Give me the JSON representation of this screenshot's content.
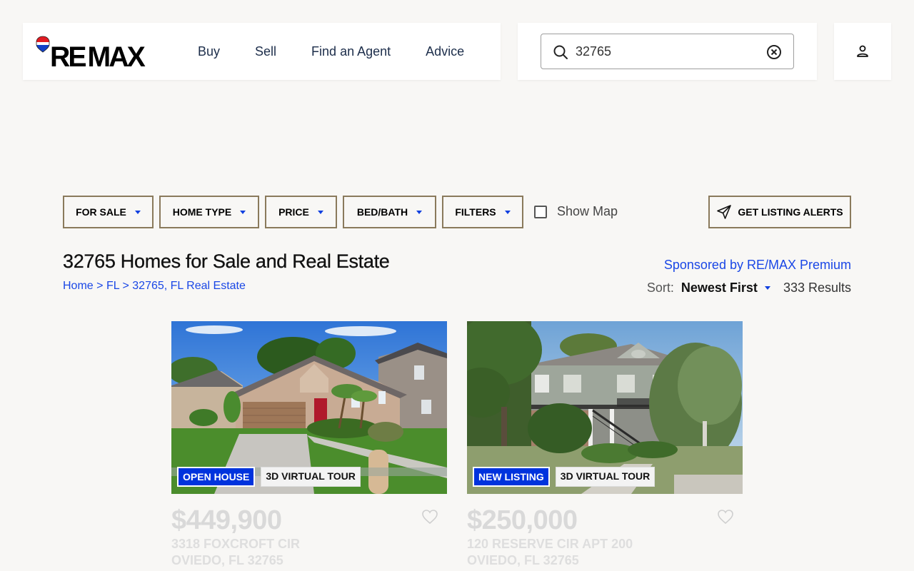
{
  "brand": {
    "logo_text": "RE/MAX",
    "logo_display": "RE/MAX"
  },
  "nav": {
    "items": [
      "Buy",
      "Sell",
      "Find an Agent",
      "Advice"
    ]
  },
  "search": {
    "value": "32765"
  },
  "filters": {
    "buttons": [
      "FOR SALE",
      "HOME TYPE",
      "PRICE",
      "BED/BATH",
      "FILTERS"
    ],
    "show_map_label": "Show Map",
    "alerts_label": "GET LISTING ALERTS"
  },
  "header": {
    "title": "32765 Homes for Sale and Real Estate",
    "breadcrumb": {
      "home": "Home",
      "sep": ">",
      "state": "FL",
      "area": "32765, FL Real Estate"
    },
    "sponsored": "Sponsored by RE/MAX Premium",
    "sort_label": "Sort:",
    "sort_value": "Newest First",
    "results": "333 Results"
  },
  "listings": [
    {
      "badge1": "OPEN HOUSE",
      "badge2": "3D VIRTUAL TOUR",
      "price": "$449,900",
      "street": "3318 FOXCROFT CIR",
      "city": "OVIEDO, FL 32765"
    },
    {
      "badge1": "NEW LISTING",
      "badge2": "3D VIRTUAL TOUR",
      "price": "$250,000",
      "street": "120 RESERVE CIR APT 200",
      "city": "OVIEDO, FL 32765"
    }
  ],
  "colors": {
    "accent_blue": "#1a47e6",
    "badge_blue": "#0033dd",
    "filter_border": "#8a7a5c",
    "background": "#f8f7f5"
  },
  "icons": {
    "search": "search-icon",
    "clear": "clear-circle-x-icon",
    "account": "person-icon",
    "alerts": "paper-plane-icon",
    "favorite": "heart-icon"
  }
}
